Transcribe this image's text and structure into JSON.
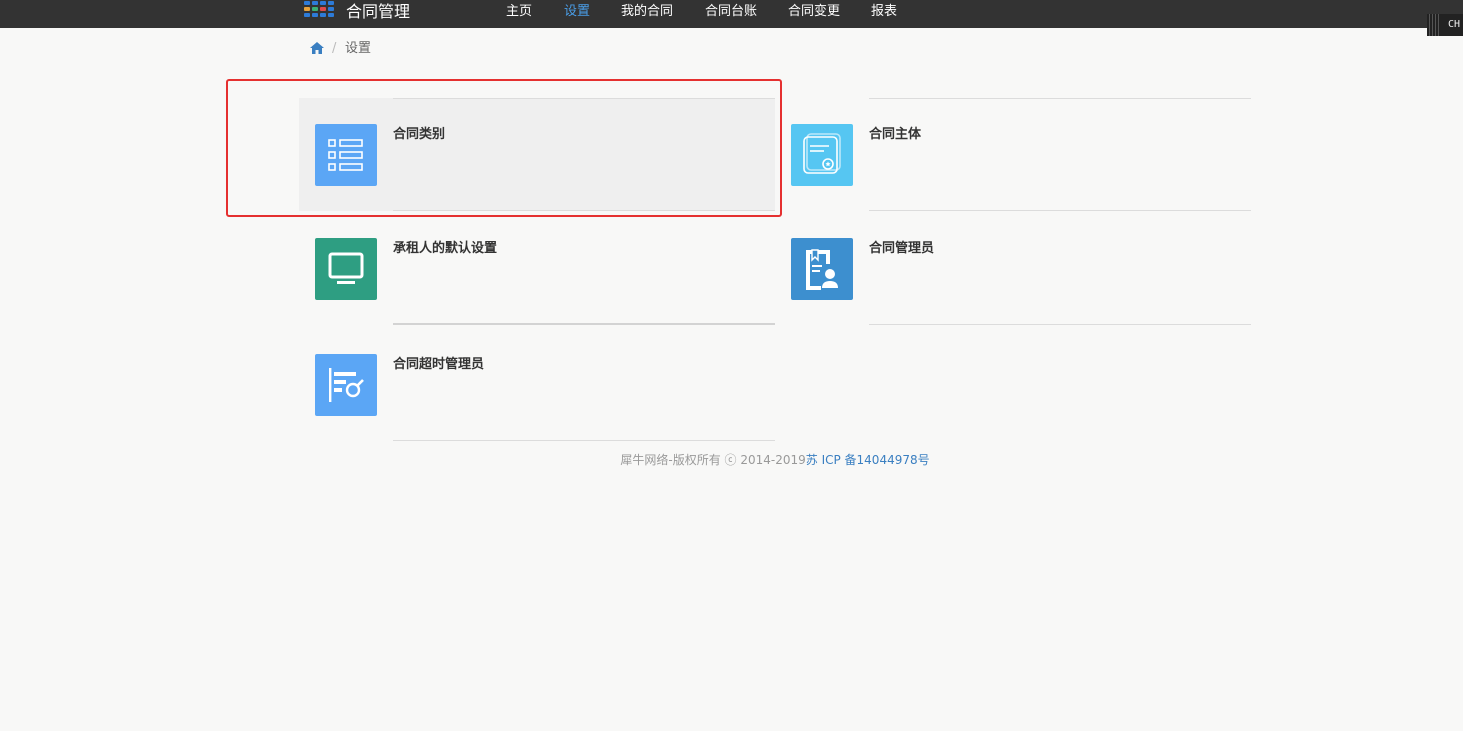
{
  "header": {
    "app_title": "合同管理",
    "nav": [
      {
        "label": "主页",
        "active": false
      },
      {
        "label": "设置",
        "active": true
      },
      {
        "label": "我的合同",
        "active": false
      },
      {
        "label": "合同台账",
        "active": false
      },
      {
        "label": "合同变更",
        "active": false
      },
      {
        "label": "报表",
        "active": false
      }
    ],
    "lang_badge": "CH"
  },
  "breadcrumb": {
    "home_icon": "home-icon",
    "separator": "/",
    "current": "设置"
  },
  "tiles": [
    {
      "label": "合同类别",
      "icon": "list-icon",
      "color": "#5ba6f5"
    },
    {
      "label": "合同主体",
      "icon": "certificate-icon",
      "color": "#56c6f2"
    },
    {
      "label": "承租人的默认设置",
      "icon": "monitor-icon",
      "color": "#2e9e82"
    },
    {
      "label": "合同管理员",
      "icon": "admin-badge-icon",
      "color": "#3d8fcf"
    },
    {
      "label": "合同超时管理员",
      "icon": "timeout-search-icon",
      "color": "#5ba6f5"
    }
  ],
  "footer": {
    "copyright": "犀牛网络-版权所有 ⓒ 2014-2019",
    "icp_link": "苏 ICP 备14044978号"
  }
}
